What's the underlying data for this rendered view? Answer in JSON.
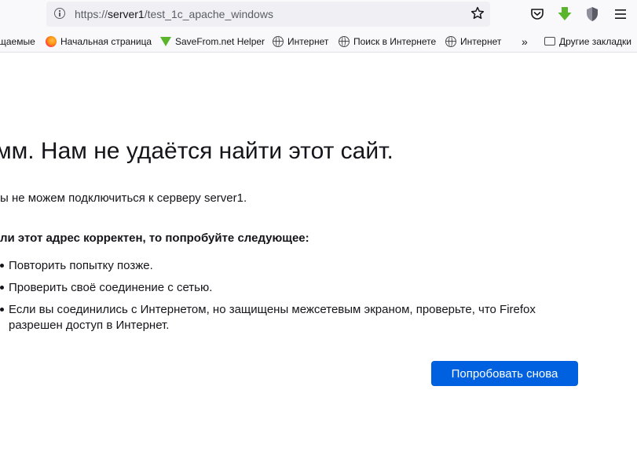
{
  "toolbar": {
    "url_scheme": "https://",
    "url_host": "server1",
    "url_path": "/test_1c_apache_windows"
  },
  "bookmarks": [
    {
      "label": "щаемые",
      "icon": "none"
    },
    {
      "label": "Начальная страница",
      "icon": "firefox-icon"
    },
    {
      "label": "SaveFrom.net Helper",
      "icon": "savefrom-icon"
    },
    {
      "label": "Интернет",
      "icon": "globe-icon"
    },
    {
      "label": "Поиск в Интернете",
      "icon": "globe-icon"
    },
    {
      "label": "Интернет",
      "icon": "globe-icon"
    }
  ],
  "other_bookmarks": "Другие закладки",
  "error": {
    "title": "мм. Нам не удаётся найти этот сайт.",
    "description": "ы не можем подключиться к серверу server1.",
    "suggest_heading": "ли этот адрес корректен, то попробуйте следующее:",
    "suggestions": [
      "Повторить попытку позже.",
      "Проверить своё соединение с сетью.",
      "Если вы соединились с Интернетом, но защищены межсетевым экраном, проверьте, что Firefox разрешен доступ в Интернет."
    ],
    "retry_label": "Попробовать снова"
  },
  "colors": {
    "accent": "#0061e0",
    "toolbar_bg": "#f9f9fb",
    "urlbar_bg": "#f0f0f4"
  }
}
